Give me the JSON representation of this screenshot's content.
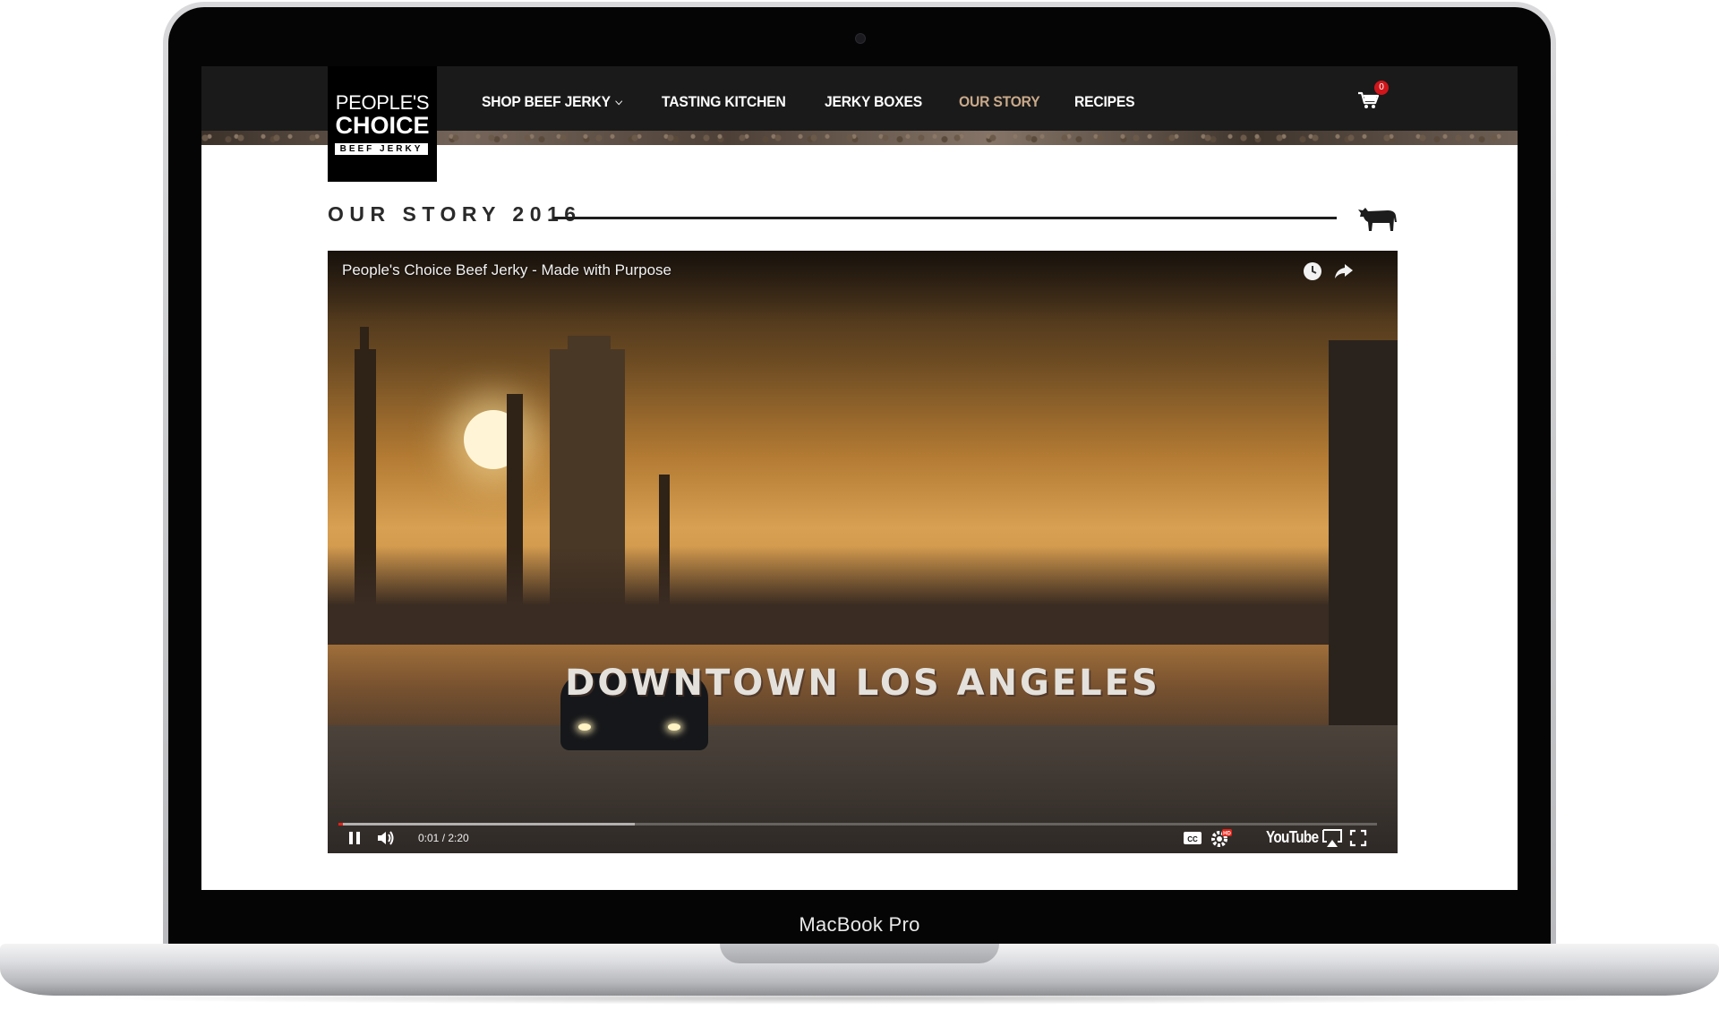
{
  "device": {
    "label": "MacBook Pro"
  },
  "site": {
    "logo": {
      "line1": "PEOPLE'S",
      "line2": "CHOICE",
      "line3": "BEEF JERKY"
    },
    "nav": [
      {
        "label": "SHOP BEEF JERKY",
        "has_dropdown": true,
        "active": false
      },
      {
        "label": "TASTING KITCHEN",
        "active": false
      },
      {
        "label": "JERKY BOXES",
        "active": false
      },
      {
        "label": "OUR STORY",
        "active": true
      },
      {
        "label": "RECIPES",
        "active": false
      }
    ],
    "cart": {
      "icon": "cart-icon",
      "count": "0"
    },
    "accent_color": "#c9a98a",
    "badge_color": "#d0161b"
  },
  "page": {
    "section_title": "OUR STORY 2016",
    "section_icon": "cow-icon"
  },
  "video": {
    "title": "People's Choice Beef Jerky - Made with Purpose",
    "overlay_text": "DOWNTOWN LOS ANGELES",
    "time": "0:01 / 2:20",
    "progress": {
      "played_fraction": 0.004,
      "buffered_fraction": 0.285
    },
    "brand": "YouTube",
    "controls": [
      "pause-icon",
      "volume-icon",
      "captions-icon",
      "settings-icon",
      "airplay-icon",
      "fullscreen-icon"
    ],
    "top_icons": [
      "watch-later-icon",
      "share-icon"
    ],
    "hd_badge": "HD"
  }
}
